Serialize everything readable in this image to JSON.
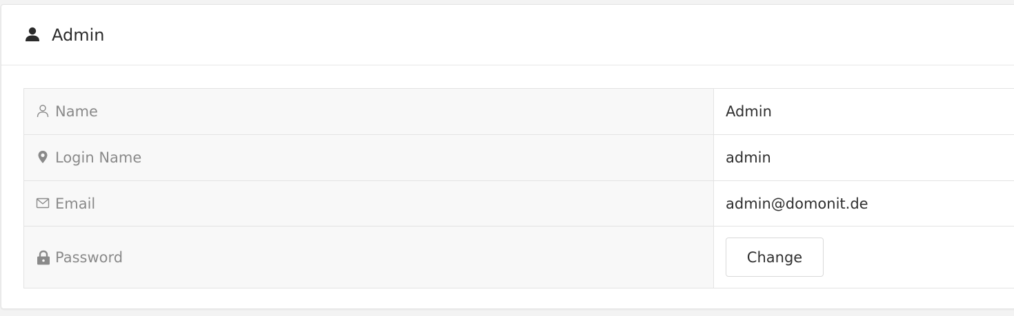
{
  "card": {
    "title": "Admin",
    "title_icon": "user-solid-icon"
  },
  "rows": [
    {
      "label": "Name",
      "icon": "user-outline-icon",
      "value": "Admin"
    },
    {
      "label": "Login Name",
      "icon": "location-pin-icon",
      "value": "admin"
    },
    {
      "label": "Email",
      "icon": "envelope-icon",
      "value": "admin@domonit.de"
    },
    {
      "label": "Password",
      "icon": "lock-icon",
      "button_label": "Change"
    }
  ],
  "colors": {
    "label_background": "#f8f8f8",
    "label_text": "#8a8a8a",
    "value_text": "#2f2f2f",
    "border": "#e3e3e3"
  }
}
